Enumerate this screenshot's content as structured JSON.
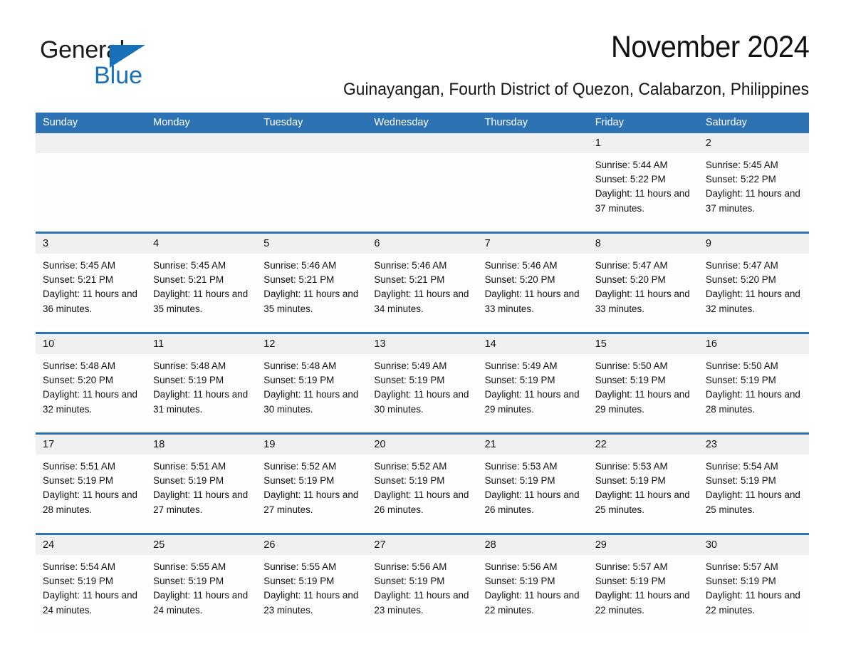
{
  "brand": {
    "name_part1": "General",
    "name_part2": "Blue",
    "logo_icon": "triangle-icon",
    "accent_color": "#1870b9"
  },
  "header": {
    "month_title": "November 2024",
    "location": "Guinayangan, Fourth District of Quezon, Calabarzon, Philippines"
  },
  "calendar": {
    "header_color": "#2d72b3",
    "weekdays": [
      "Sunday",
      "Monday",
      "Tuesday",
      "Wednesday",
      "Thursday",
      "Friday",
      "Saturday"
    ],
    "weeks": [
      [
        {
          "day": "",
          "empty": true
        },
        {
          "day": "",
          "empty": true
        },
        {
          "day": "",
          "empty": true
        },
        {
          "day": "",
          "empty": true
        },
        {
          "day": "",
          "empty": true
        },
        {
          "day": "1",
          "sunrise": "Sunrise: 5:44 AM",
          "sunset": "Sunset: 5:22 PM",
          "daylight": "Daylight: 11 hours and 37 minutes."
        },
        {
          "day": "2",
          "sunrise": "Sunrise: 5:45 AM",
          "sunset": "Sunset: 5:22 PM",
          "daylight": "Daylight: 11 hours and 37 minutes."
        }
      ],
      [
        {
          "day": "3",
          "sunrise": "Sunrise: 5:45 AM",
          "sunset": "Sunset: 5:21 PM",
          "daylight": "Daylight: 11 hours and 36 minutes."
        },
        {
          "day": "4",
          "sunrise": "Sunrise: 5:45 AM",
          "sunset": "Sunset: 5:21 PM",
          "daylight": "Daylight: 11 hours and 35 minutes."
        },
        {
          "day": "5",
          "sunrise": "Sunrise: 5:46 AM",
          "sunset": "Sunset: 5:21 PM",
          "daylight": "Daylight: 11 hours and 35 minutes."
        },
        {
          "day": "6",
          "sunrise": "Sunrise: 5:46 AM",
          "sunset": "Sunset: 5:21 PM",
          "daylight": "Daylight: 11 hours and 34 minutes."
        },
        {
          "day": "7",
          "sunrise": "Sunrise: 5:46 AM",
          "sunset": "Sunset: 5:20 PM",
          "daylight": "Daylight: 11 hours and 33 minutes."
        },
        {
          "day": "8",
          "sunrise": "Sunrise: 5:47 AM",
          "sunset": "Sunset: 5:20 PM",
          "daylight": "Daylight: 11 hours and 33 minutes."
        },
        {
          "day": "9",
          "sunrise": "Sunrise: 5:47 AM",
          "sunset": "Sunset: 5:20 PM",
          "daylight": "Daylight: 11 hours and 32 minutes."
        }
      ],
      [
        {
          "day": "10",
          "sunrise": "Sunrise: 5:48 AM",
          "sunset": "Sunset: 5:20 PM",
          "daylight": "Daylight: 11 hours and 32 minutes."
        },
        {
          "day": "11",
          "sunrise": "Sunrise: 5:48 AM",
          "sunset": "Sunset: 5:19 PM",
          "daylight": "Daylight: 11 hours and 31 minutes."
        },
        {
          "day": "12",
          "sunrise": "Sunrise: 5:48 AM",
          "sunset": "Sunset: 5:19 PM",
          "daylight": "Daylight: 11 hours and 30 minutes."
        },
        {
          "day": "13",
          "sunrise": "Sunrise: 5:49 AM",
          "sunset": "Sunset: 5:19 PM",
          "daylight": "Daylight: 11 hours and 30 minutes."
        },
        {
          "day": "14",
          "sunrise": "Sunrise: 5:49 AM",
          "sunset": "Sunset: 5:19 PM",
          "daylight": "Daylight: 11 hours and 29 minutes."
        },
        {
          "day": "15",
          "sunrise": "Sunrise: 5:50 AM",
          "sunset": "Sunset: 5:19 PM",
          "daylight": "Daylight: 11 hours and 29 minutes."
        },
        {
          "day": "16",
          "sunrise": "Sunrise: 5:50 AM",
          "sunset": "Sunset: 5:19 PM",
          "daylight": "Daylight: 11 hours and 28 minutes."
        }
      ],
      [
        {
          "day": "17",
          "sunrise": "Sunrise: 5:51 AM",
          "sunset": "Sunset: 5:19 PM",
          "daylight": "Daylight: 11 hours and 28 minutes."
        },
        {
          "day": "18",
          "sunrise": "Sunrise: 5:51 AM",
          "sunset": "Sunset: 5:19 PM",
          "daylight": "Daylight: 11 hours and 27 minutes."
        },
        {
          "day": "19",
          "sunrise": "Sunrise: 5:52 AM",
          "sunset": "Sunset: 5:19 PM",
          "daylight": "Daylight: 11 hours and 27 minutes."
        },
        {
          "day": "20",
          "sunrise": "Sunrise: 5:52 AM",
          "sunset": "Sunset: 5:19 PM",
          "daylight": "Daylight: 11 hours and 26 minutes."
        },
        {
          "day": "21",
          "sunrise": "Sunrise: 5:53 AM",
          "sunset": "Sunset: 5:19 PM",
          "daylight": "Daylight: 11 hours and 26 minutes."
        },
        {
          "day": "22",
          "sunrise": "Sunrise: 5:53 AM",
          "sunset": "Sunset: 5:19 PM",
          "daylight": "Daylight: 11 hours and 25 minutes."
        },
        {
          "day": "23",
          "sunrise": "Sunrise: 5:54 AM",
          "sunset": "Sunset: 5:19 PM",
          "daylight": "Daylight: 11 hours and 25 minutes."
        }
      ],
      [
        {
          "day": "24",
          "sunrise": "Sunrise: 5:54 AM",
          "sunset": "Sunset: 5:19 PM",
          "daylight": "Daylight: 11 hours and 24 minutes."
        },
        {
          "day": "25",
          "sunrise": "Sunrise: 5:55 AM",
          "sunset": "Sunset: 5:19 PM",
          "daylight": "Daylight: 11 hours and 24 minutes."
        },
        {
          "day": "26",
          "sunrise": "Sunrise: 5:55 AM",
          "sunset": "Sunset: 5:19 PM",
          "daylight": "Daylight: 11 hours and 23 minutes."
        },
        {
          "day": "27",
          "sunrise": "Sunrise: 5:56 AM",
          "sunset": "Sunset: 5:19 PM",
          "daylight": "Daylight: 11 hours and 23 minutes."
        },
        {
          "day": "28",
          "sunrise": "Sunrise: 5:56 AM",
          "sunset": "Sunset: 5:19 PM",
          "daylight": "Daylight: 11 hours and 22 minutes."
        },
        {
          "day": "29",
          "sunrise": "Sunrise: 5:57 AM",
          "sunset": "Sunset: 5:19 PM",
          "daylight": "Daylight: 11 hours and 22 minutes."
        },
        {
          "day": "30",
          "sunrise": "Sunrise: 5:57 AM",
          "sunset": "Sunset: 5:19 PM",
          "daylight": "Daylight: 11 hours and 22 minutes."
        }
      ]
    ]
  }
}
